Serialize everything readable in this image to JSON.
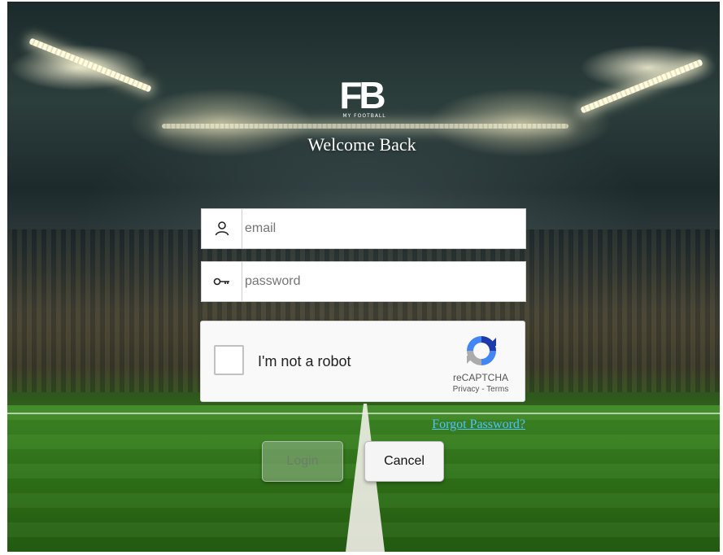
{
  "brand": {
    "logo_letters": "FB",
    "logo_sub": "MY FOOTBALL"
  },
  "header": {
    "welcome": "Welcome Back"
  },
  "form": {
    "email_placeholder": "email",
    "email_value": "",
    "password_placeholder": "password",
    "password_value": ""
  },
  "recaptcha": {
    "label": "I'm not a robot",
    "brand": "reCAPTCHA",
    "links": "Privacy - Terms",
    "checked": false
  },
  "links": {
    "forgot_password": "Forgot Password?"
  },
  "buttons": {
    "login": "Login",
    "cancel": "Cancel"
  },
  "colors": {
    "forgot_link": "#4fc3ff",
    "login_disabled": "#96b48c"
  },
  "icons": {
    "email": "user-icon",
    "password": "key-icon",
    "recaptcha": "recaptcha-logo-icon"
  }
}
